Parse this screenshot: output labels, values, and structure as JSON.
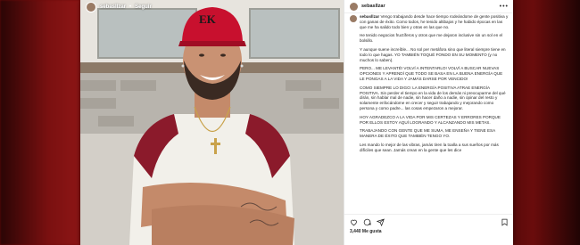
{
  "post": {
    "username": "sebasllzar",
    "follow_label": "Seguir",
    "separator": "•",
    "more_label": "•••",
    "likes": "3,440 Me gusta",
    "date": "",
    "cap_label": "EK"
  },
  "caption": {
    "paragraphs": [
      "Vengo trabajando desde hace tiempo rodeándome de gente positiva y con ganas de éxito. Como todos, he tenido altibajos y he habido épocas en las que me ha salido todo bien y otras en las que no.",
      "He tenido negocios fructíferos y otros que me dejaron inclusive sin un sol en el bolsillo.",
      "Y aunque suene increíble... No sol per metáfora sino que literal siempre tiene en todo lo que hagas. YO TAMBIÉN TOQUÉ FONDO EN SU MOMENTO (y no muchos lo saben).",
      "PERO... ME LEVANTÉ! VOLVÍ A INTENTARLO! VOLVÍ A BUSCAR NUEVAS OPCIONES Y APRENDÍ QUE TODO SE BASA EN LA BUENA ENERGÍA QUE LE PONGAS A LA VIDA Y JAMÁS DARSE POR VENCIDO!",
      "COMO SIEMPRE LO DIGO: LA ENERGÍA POSITIVA ATRAE ENERGÍA POSITIVA. Sin perder el tiempo en la vida de los demás ni preocuparme del qué dirán, sin hablar mal de nadie, sin hacer daño a nadie, sin opinar del resto y solamente enfocándome en crecer y seguir trabajando y mejorando como persona y como padre... las cosas empezaron a mejorar.",
      "HOY AGRADEZCO A LA VIDA POR MIS CERTEZAS Y ERRORES PORQUE POR ELLOS ESTOY AQUÍ LOGRANDO Y ALCANZANDO MIS METAS.",
      "TRABAJANDO CON GENTE QUE ME SUMA, ME ENSEÑA Y TIENE ESA MANERA DE ÉXITO QUE TAMBIÉN TENGO YO.",
      "Les mando lo mejor de las vibras, jamás tiren la toalla a sus sueños por más difíciles que sean. Jamás crean en la gente que les dice"
    ]
  },
  "colors": {
    "cap": "#c8102e",
    "shirt_sleeve": "#8b1a2b",
    "shirt_body": "#f2f0ea",
    "skin": "#c99273",
    "kitchen_bg": "#d9d6cf",
    "blur_left": "#7a1010"
  }
}
